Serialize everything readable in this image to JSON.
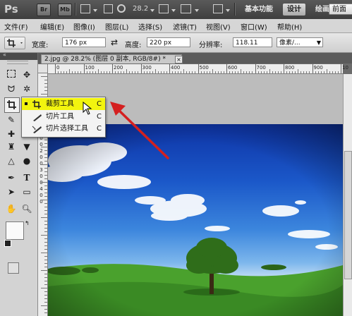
{
  "titlebar": {
    "logo": "Ps",
    "bridge_btn": "Br",
    "minibridge_btn": "Mb",
    "zoom": "28.2",
    "workspaces": [
      "基本功能",
      "设计",
      "绘画"
    ]
  },
  "menu": [
    "文件(F)",
    "编辑(E)",
    "图像(I)",
    "图层(L)",
    "选择(S)",
    "滤镜(T)",
    "视图(V)",
    "窗口(W)",
    "帮助(H)"
  ],
  "options": {
    "width_label": "宽度:",
    "width_value": "176 px",
    "height_label": "高度:",
    "height_value": "220 px",
    "resolution_label": "分辨率:",
    "resolution_value": "118.11",
    "unit": "像素/...",
    "front_image_btn": "前面"
  },
  "document": {
    "tab_title": "2.jpg @ 28.2% (图层 0 副本, RGB/8#) *",
    "close": "×",
    "ruler_top": [
      "0",
      "100",
      "200",
      "300",
      "400",
      "500",
      "600",
      "700",
      "800",
      "900",
      "10"
    ],
    "ruler_left": [
      "0",
      "1",
      "0",
      "0",
      "2",
      "0",
      "0",
      "3",
      "0",
      "0",
      "4",
      "0",
      "0"
    ]
  },
  "tool_flyout": {
    "items": [
      {
        "label": "裁剪工具",
        "key": "C",
        "selected": true
      },
      {
        "label": "切片工具",
        "key": "C",
        "selected": false
      },
      {
        "label": "切片选择工具",
        "key": "C",
        "selected": false
      }
    ]
  },
  "colors": {
    "highlight": "#f2f40f",
    "arrow": "#d42020",
    "sky": "#1b58c9",
    "grass": "#3f9428"
  }
}
